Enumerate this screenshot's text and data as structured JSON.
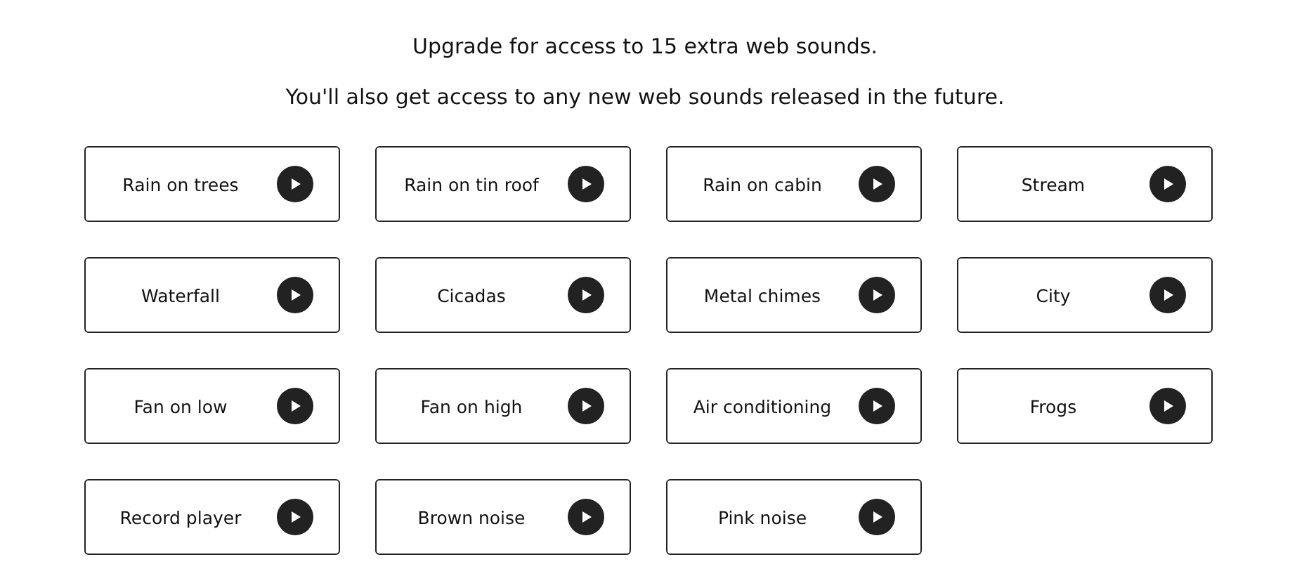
{
  "headline": "Upgrade for access to 15 extra web sounds.",
  "subline": "You'll also get access to any new web sounds released in the future.",
  "sounds": [
    {
      "label": "Rain on trees"
    },
    {
      "label": "Rain on tin roof"
    },
    {
      "label": "Rain on cabin"
    },
    {
      "label": "Stream"
    },
    {
      "label": "Waterfall"
    },
    {
      "label": "Cicadas"
    },
    {
      "label": "Metal chimes"
    },
    {
      "label": "City"
    },
    {
      "label": "Fan on low"
    },
    {
      "label": "Fan on high"
    },
    {
      "label": "Air conditioning"
    },
    {
      "label": "Frogs"
    },
    {
      "label": "Record player"
    },
    {
      "label": "Brown noise"
    },
    {
      "label": "Pink noise"
    }
  ]
}
